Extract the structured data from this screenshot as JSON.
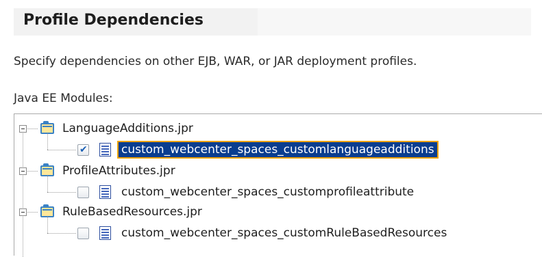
{
  "panel": {
    "title": "Profile Dependencies",
    "description": "Specify dependencies on other EJB, WAR, or JAR deployment profiles.",
    "modules_label": "Java EE Modules:"
  },
  "tree": {
    "projects": [
      {
        "name": "LanguageAdditions.jpr",
        "expanded": true,
        "profile": {
          "name": "custom_webcenter_spaces_customlanguageadditions",
          "checked": true,
          "selected": true
        }
      },
      {
        "name": "ProfileAttributes.jpr",
        "expanded": true,
        "profile": {
          "name": "custom_webcenter_spaces_customprofileattribute",
          "checked": false,
          "selected": false
        }
      },
      {
        "name": "RuleBasedResources.jpr",
        "expanded": true,
        "profile": {
          "name": "custom_webcenter_spaces_customRuleBasedResources",
          "checked": false,
          "selected": false
        }
      }
    ]
  },
  "colors": {
    "selection_bg": "#0a3d8f",
    "selection_outline": "#f0a30a",
    "folder_fill": "#ffe79a",
    "folder_border": "#3b82c4"
  },
  "icons": {
    "expander": "minus-box",
    "project": "folder-icon",
    "profile": "document-icon",
    "checked": "✔"
  }
}
